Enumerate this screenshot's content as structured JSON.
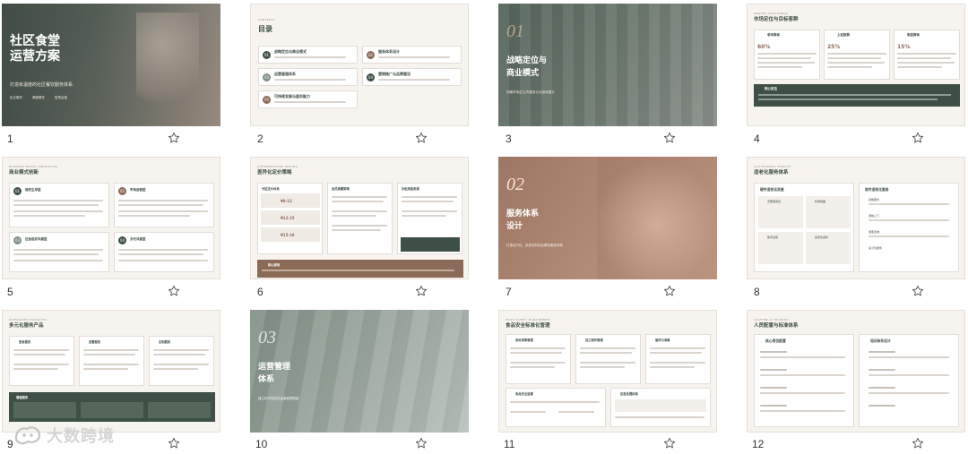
{
  "slides": [
    {
      "num": "1",
      "title_line1": "社区食堂",
      "title_line2": "运营方案",
      "subtitle": "打造有温度的社区餐饮服务体系",
      "tags": [
        "民生服务",
        "健康餐饮",
        "智慧运营"
      ]
    },
    {
      "num": "2",
      "heading": "目录",
      "items": [
        {
          "n": "01",
          "label": "战略定位与商业模式"
        },
        {
          "n": "02",
          "label": "服务体系设计"
        },
        {
          "n": "03",
          "label": "运营管理体系"
        },
        {
          "n": "04",
          "label": "营销推广与品牌建设"
        },
        {
          "n": "05",
          "label": "可持续发展与盈利能力"
        }
      ]
    },
    {
      "num": "3",
      "big_num": "01",
      "title_line1": "战略定位与",
      "title_line2": "商业模式",
      "desc": "明确市场定位,构建多元化营收模式"
    },
    {
      "num": "4",
      "heading": "市场定位与目标客群",
      "groups": [
        {
          "label": "老年群体",
          "pct": "60%"
        },
        {
          "label": "上班族群",
          "pct": "25%"
        },
        {
          "label": "家庭群体",
          "pct": "15%"
        }
      ],
      "note": "核心定位"
    },
    {
      "num": "5",
      "heading": "商业模式创新",
      "cards": [
        {
          "n": "01",
          "label": "政府主导型"
        },
        {
          "n": "02",
          "label": "市场运营型"
        },
        {
          "n": "03",
          "label": "社会组织共建型"
        },
        {
          "n": "04",
          "label": "多元共建型"
        }
      ]
    },
    {
      "num": "6",
      "heading": "差异化定价策略",
      "cols": [
        "分层定价体系",
        "会员套餐策略",
        "补贴资金来源"
      ],
      "prices": [
        "¥8-12",
        "¥12-15",
        "¥15-18"
      ],
      "footer": "核心原则"
    },
    {
      "num": "7",
      "big_num": "02",
      "title_line1": "服务体系",
      "title_line2": "设计",
      "desc": "打造全方位、多层次的社区餐饮服务体系"
    },
    {
      "num": "8",
      "heading": "适老化服务体系",
      "left_title": "硬件适老化改造",
      "right_title": "软件适老化服务",
      "items": [
        "无障碍通道",
        "防滑地面",
        "助手设施",
        "适老化桌椅",
        "就餐服务",
        "送餐上门",
        "健康咨询",
        "多元化服务"
      ]
    },
    {
      "num": "9",
      "heading": "多元化服务产品",
      "cols": [
        "堂食服务",
        "送餐服务",
        "定制服务"
      ],
      "bottom": "增值服务"
    },
    {
      "num": "10",
      "big_num": "03",
      "title_line1": "运营管理",
      "title_line2": "体系",
      "desc": "建立科学规范的运营管理制度"
    },
    {
      "num": "11",
      "heading": "食品安全标准化管理",
      "cols": [
        "食材采购管理",
        "加工制作管理",
        "留样与消毒"
      ],
      "bottom_left": "食品安全监督",
      "bottom_right": "应急处理机制"
    },
    {
      "num": "12",
      "heading": "人员配置与标准体系",
      "left_title": "核心岗位配置",
      "right_title": "培训体系设计"
    }
  ],
  "watermark": "大数跨境"
}
